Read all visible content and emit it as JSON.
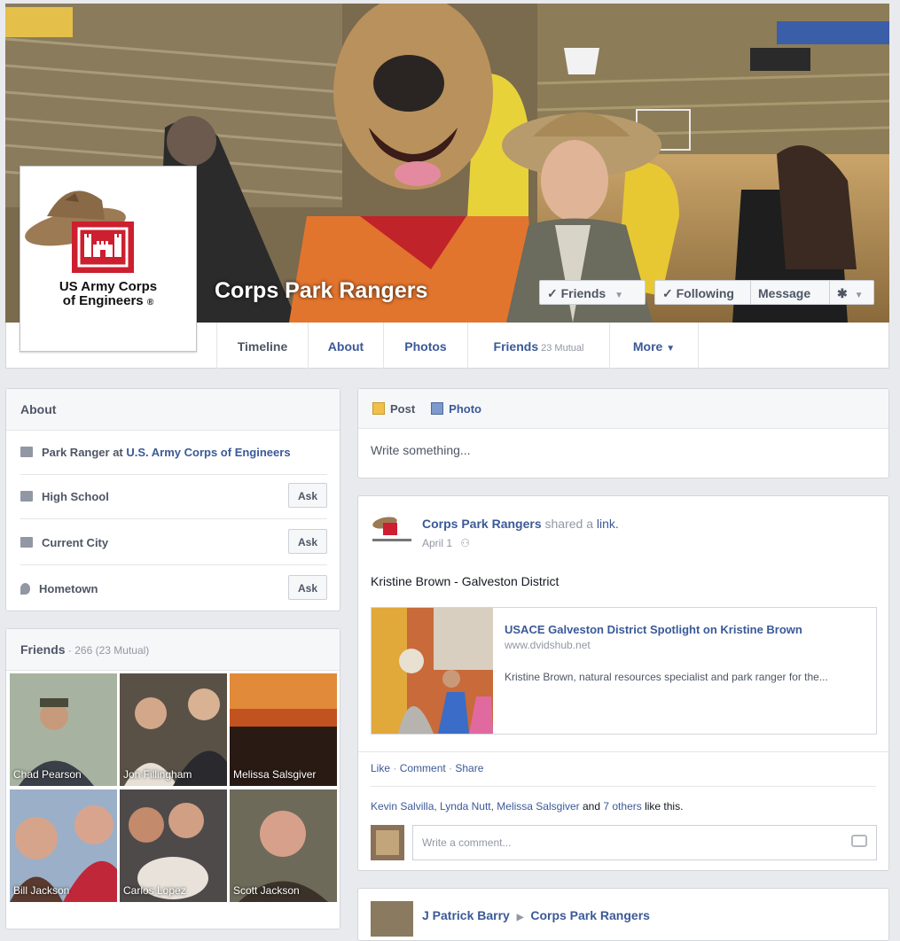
{
  "page": {
    "name": "Corps Park Rangers",
    "logo_text_line1": "US Army Corps",
    "logo_text_line2": "of Engineers",
    "registered_mark": "®"
  },
  "cover_buttons": {
    "friends": "✓ Friends",
    "following": "✓ Following",
    "message": "Message",
    "settings": "✱"
  },
  "tabs": [
    {
      "label": "Timeline"
    },
    {
      "label": "About"
    },
    {
      "label": "Photos"
    },
    {
      "label": "Friends",
      "sub": "23 Mutual"
    },
    {
      "label": "More"
    }
  ],
  "about": {
    "title": "About",
    "work_prefix": "Park Ranger at ",
    "work_link": "U.S. Army Corps of Engineers",
    "rows": [
      {
        "label": "High School",
        "button": "Ask"
      },
      {
        "label": "Current City",
        "button": "Ask"
      },
      {
        "label": "Hometown",
        "button": "Ask"
      }
    ]
  },
  "friends": {
    "title": "Friends",
    "count": " · 266 (23 Mutual)",
    "tiles": [
      {
        "name": "Chad Pearson",
        "color": "#8a8f7a"
      },
      {
        "name": "Jon Fillingham",
        "color": "#5a5146"
      },
      {
        "name": "Melissa Salsgiver",
        "color": "#b4461e"
      },
      {
        "name": "Bill Jackson",
        "color": "#7e6a55"
      },
      {
        "name": "Carlos Lopez",
        "color": "#4f4a4a"
      },
      {
        "name": "Scott Jackson",
        "color": "#6e6a5a"
      }
    ]
  },
  "composer": {
    "post_tab": "Post",
    "photo_tab": "Photo",
    "placeholder": "Write something..."
  },
  "post": {
    "author": "Corps Park Rangers",
    "action": " shared a ",
    "action_link": "link.",
    "date": "April 1",
    "text": "Kristine Brown - Galveston District",
    "link_title": "USACE Galveston District Spotlight on Kristine Brown",
    "link_domain": "www.dvidshub.net",
    "link_desc": "Kristine Brown, natural resources specialist and park ranger for the...",
    "like": "Like",
    "comment": "Comment",
    "share": "Share",
    "sep": " · ",
    "likes_names": "Kevin Salvilla, Lynda Nutt, Melissa Salsgiver",
    "likes_and": " and ",
    "likes_others": "7 others",
    "likes_suffix": " like this.",
    "comment_placeholder": "Write a comment..."
  },
  "next_post": {
    "author": "J Patrick Barry",
    "arrow": "▶",
    "target": "Corps Park Rangers"
  },
  "colors": {
    "link": "#3b5998",
    "usace_red": "#cc1f2f",
    "background": "#e9eaed"
  }
}
